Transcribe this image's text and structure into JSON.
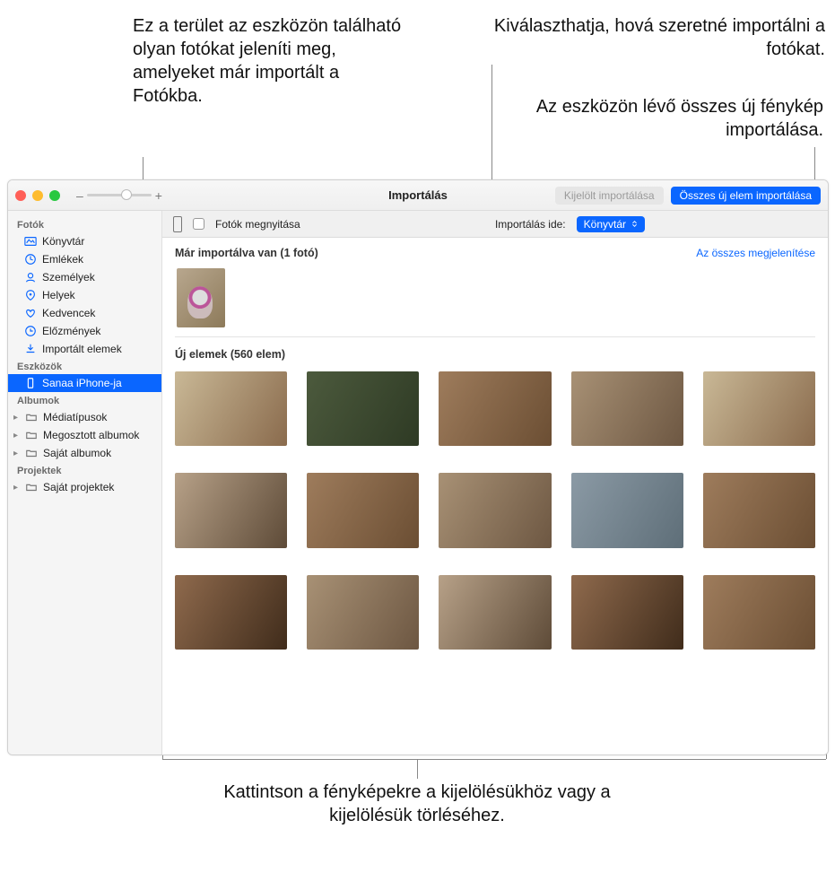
{
  "annotations": {
    "top_left": "Ez a terület az eszközön található olyan fotókat jeleníti meg, amelyeket már importált a Fotókba.",
    "top_right1": "Kiválaszthatja, hová szeretné importálni a fotókat.",
    "top_right2": "Az eszközön lévő összes új fénykép importálása.",
    "bottom": "Kattintson a fényképekre a kijelölésükhöz vagy a kijelölésük törléséhez."
  },
  "titlebar": {
    "zoom_minus": "–",
    "zoom_plus": "+",
    "title": "Importálás",
    "btn_import_selected": "Kijelölt importálása",
    "btn_import_all": "Összes új elem importálása"
  },
  "sidebar": {
    "section_photos": "Fotók",
    "items_photos": [
      "Könyvtár",
      "Emlékek",
      "Személyek",
      "Helyek",
      "Kedvencek",
      "Előzmények",
      "Importált elemek"
    ],
    "section_devices": "Eszközök",
    "device_name": "Sanaa iPhone-ja",
    "section_albums": "Albumok",
    "items_albums": [
      "Médiatípusok",
      "Megosztott albumok",
      "Saját albumok"
    ],
    "section_projects": "Projektek",
    "items_projects": [
      "Saját projektek"
    ]
  },
  "subbar": {
    "open_photos": "Fotók megnyitása",
    "import_to_label": "Importálás ide:",
    "import_to_value": "Könyvtár"
  },
  "content": {
    "already_imported": "Már importálva van (1 fotó)",
    "show_all": "Az összes megjelenítése",
    "new_items": "Új elemek (560 elem)"
  }
}
